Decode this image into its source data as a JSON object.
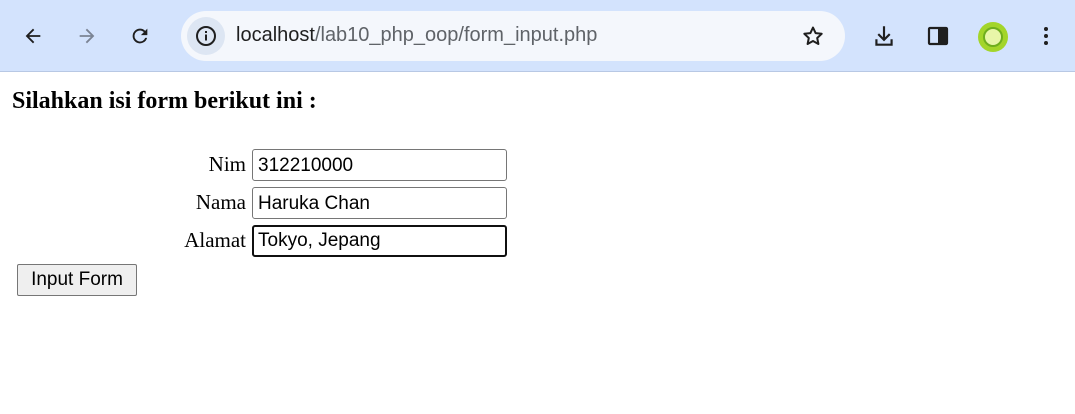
{
  "browser": {
    "url_host": "localhost",
    "url_path": "/lab10_php_oop/form_input.php",
    "icons": {
      "back": "arrow-left-icon",
      "forward": "arrow-right-icon",
      "reload": "reload-icon",
      "site_info": "info-circle-icon",
      "bookmark": "star-icon",
      "download": "download-icon",
      "side_panel": "side-panel-icon",
      "profile": "profile-avatar",
      "menu": "kebab-menu-icon"
    },
    "colors": {
      "toolbar": "#d3e3fd",
      "omnibox": "#f4f7fc"
    }
  },
  "page": {
    "title": "Silahkan isi form berikut ini :",
    "fields": [
      {
        "label": "Nim",
        "value": "312210000"
      },
      {
        "label": "Nama",
        "value": "Haruka Chan"
      },
      {
        "label": "Alamat",
        "value": "Tokyo, Jepang"
      }
    ],
    "submit_label": "Input Form"
  }
}
